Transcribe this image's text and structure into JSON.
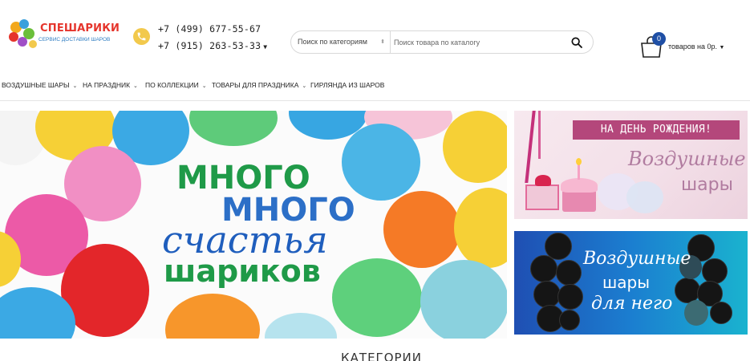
{
  "header": {
    "logo": {
      "title": "СПЕШАРИКИ",
      "subtitle": "СЕРВИС ДОСТАВКИ ШАРОВ"
    },
    "phones": [
      "+7 (499) 677-55-67",
      "+7 (915) 263-53-33"
    ],
    "phone_icon": "phone-icon",
    "search": {
      "category_placeholder": "Поиск по категориям",
      "input_placeholder": "Поиск товара по каталогу",
      "button_icon": "search-icon"
    },
    "cart": {
      "count": "0",
      "label": "товаров на 0р."
    }
  },
  "nav": {
    "items": [
      {
        "label": "ВОЗДУШНЫЕ ШАРЫ",
        "has_dropdown": true
      },
      {
        "label": "НА ПРАЗДНИК",
        "has_dropdown": true
      },
      {
        "label": "ПО КОЛЛЕКЦИИ",
        "has_dropdown": true
      },
      {
        "label": "ТОВАРЫ ДЛЯ ПРАЗДНИКА",
        "has_dropdown": true
      },
      {
        "label": "ГИРЛЯНДА ИЗ ШАРОВ",
        "has_dropdown": false
      }
    ]
  },
  "hero": {
    "line1": "МНОГО",
    "line2": "МНОГО",
    "line3": "счастья",
    "line4": "шариков"
  },
  "banners": [
    {
      "title": "НА ДЕНЬ РОЖДЕНИЯ!",
      "line1": "Воздушные",
      "line2": "шары"
    },
    {
      "line1": "Воздушные",
      "line2": "шары",
      "line3": "для него"
    }
  ],
  "section_title": "КАТЕГОРИИ",
  "colors": {
    "brand_red": "#e5342b",
    "accent_blue": "#1f4fa5",
    "hero_green": "#1f9a48",
    "hero_blue": "#2c6fc7",
    "banner_pink": "#b4477b"
  }
}
